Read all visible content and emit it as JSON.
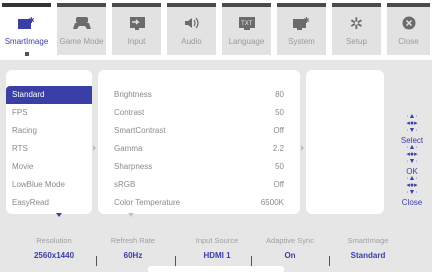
{
  "tabs": [
    {
      "label": "SmartImage",
      "icon": "smartimage-icon",
      "active": true
    },
    {
      "label": "Game Mode",
      "icon": "gamepad-icon",
      "active": false
    },
    {
      "label": "Input",
      "icon": "input-icon",
      "active": false
    },
    {
      "label": "Audio",
      "icon": "speaker-icon",
      "active": false
    },
    {
      "label": "Language",
      "icon": "language-txt-icon",
      "active": false
    },
    {
      "label": "System",
      "icon": "monitor-gear-icon",
      "active": false
    },
    {
      "label": "Setup",
      "icon": "gear-icon",
      "active": false
    },
    {
      "label": "Close",
      "icon": "close-icon",
      "active": false
    }
  ],
  "presets": [
    {
      "label": "Standard",
      "selected": true
    },
    {
      "label": "FPS"
    },
    {
      "label": "Racing"
    },
    {
      "label": "RTS"
    },
    {
      "label": "Movie"
    },
    {
      "label": "LowBlue Mode"
    },
    {
      "label": "EasyRead"
    }
  ],
  "settings": [
    {
      "name": "Brightness",
      "value": "80"
    },
    {
      "name": "Contrast",
      "value": "50"
    },
    {
      "name": "SmartContrast",
      "value": "Off"
    },
    {
      "name": "Gamma",
      "value": "2.2"
    },
    {
      "name": "Sharpness",
      "value": "50"
    },
    {
      "name": "sRGB",
      "value": "Off"
    },
    {
      "name": "Color Temperature",
      "value": "6500K"
    }
  ],
  "hints": [
    {
      "label": "Select",
      "icon": "joystick-press-icon"
    },
    {
      "label": "OK",
      "icon": "joystick-right-icon"
    },
    {
      "label": "Close",
      "icon": "joystick-left-icon"
    }
  ],
  "status": [
    {
      "key": "Resolution",
      "value": "2560x1440"
    },
    {
      "key": "Refresh Rate",
      "value": "60Hz"
    },
    {
      "key": "Input Source",
      "value": "HDMI 1"
    },
    {
      "key": "Adaptive Sync",
      "value": "On"
    },
    {
      "key": "SmartImage",
      "value": "Standard"
    }
  ],
  "colors": {
    "accent": "#3a3fa6",
    "panel": "#e6e6e6",
    "tab": "#e2e2e2"
  }
}
